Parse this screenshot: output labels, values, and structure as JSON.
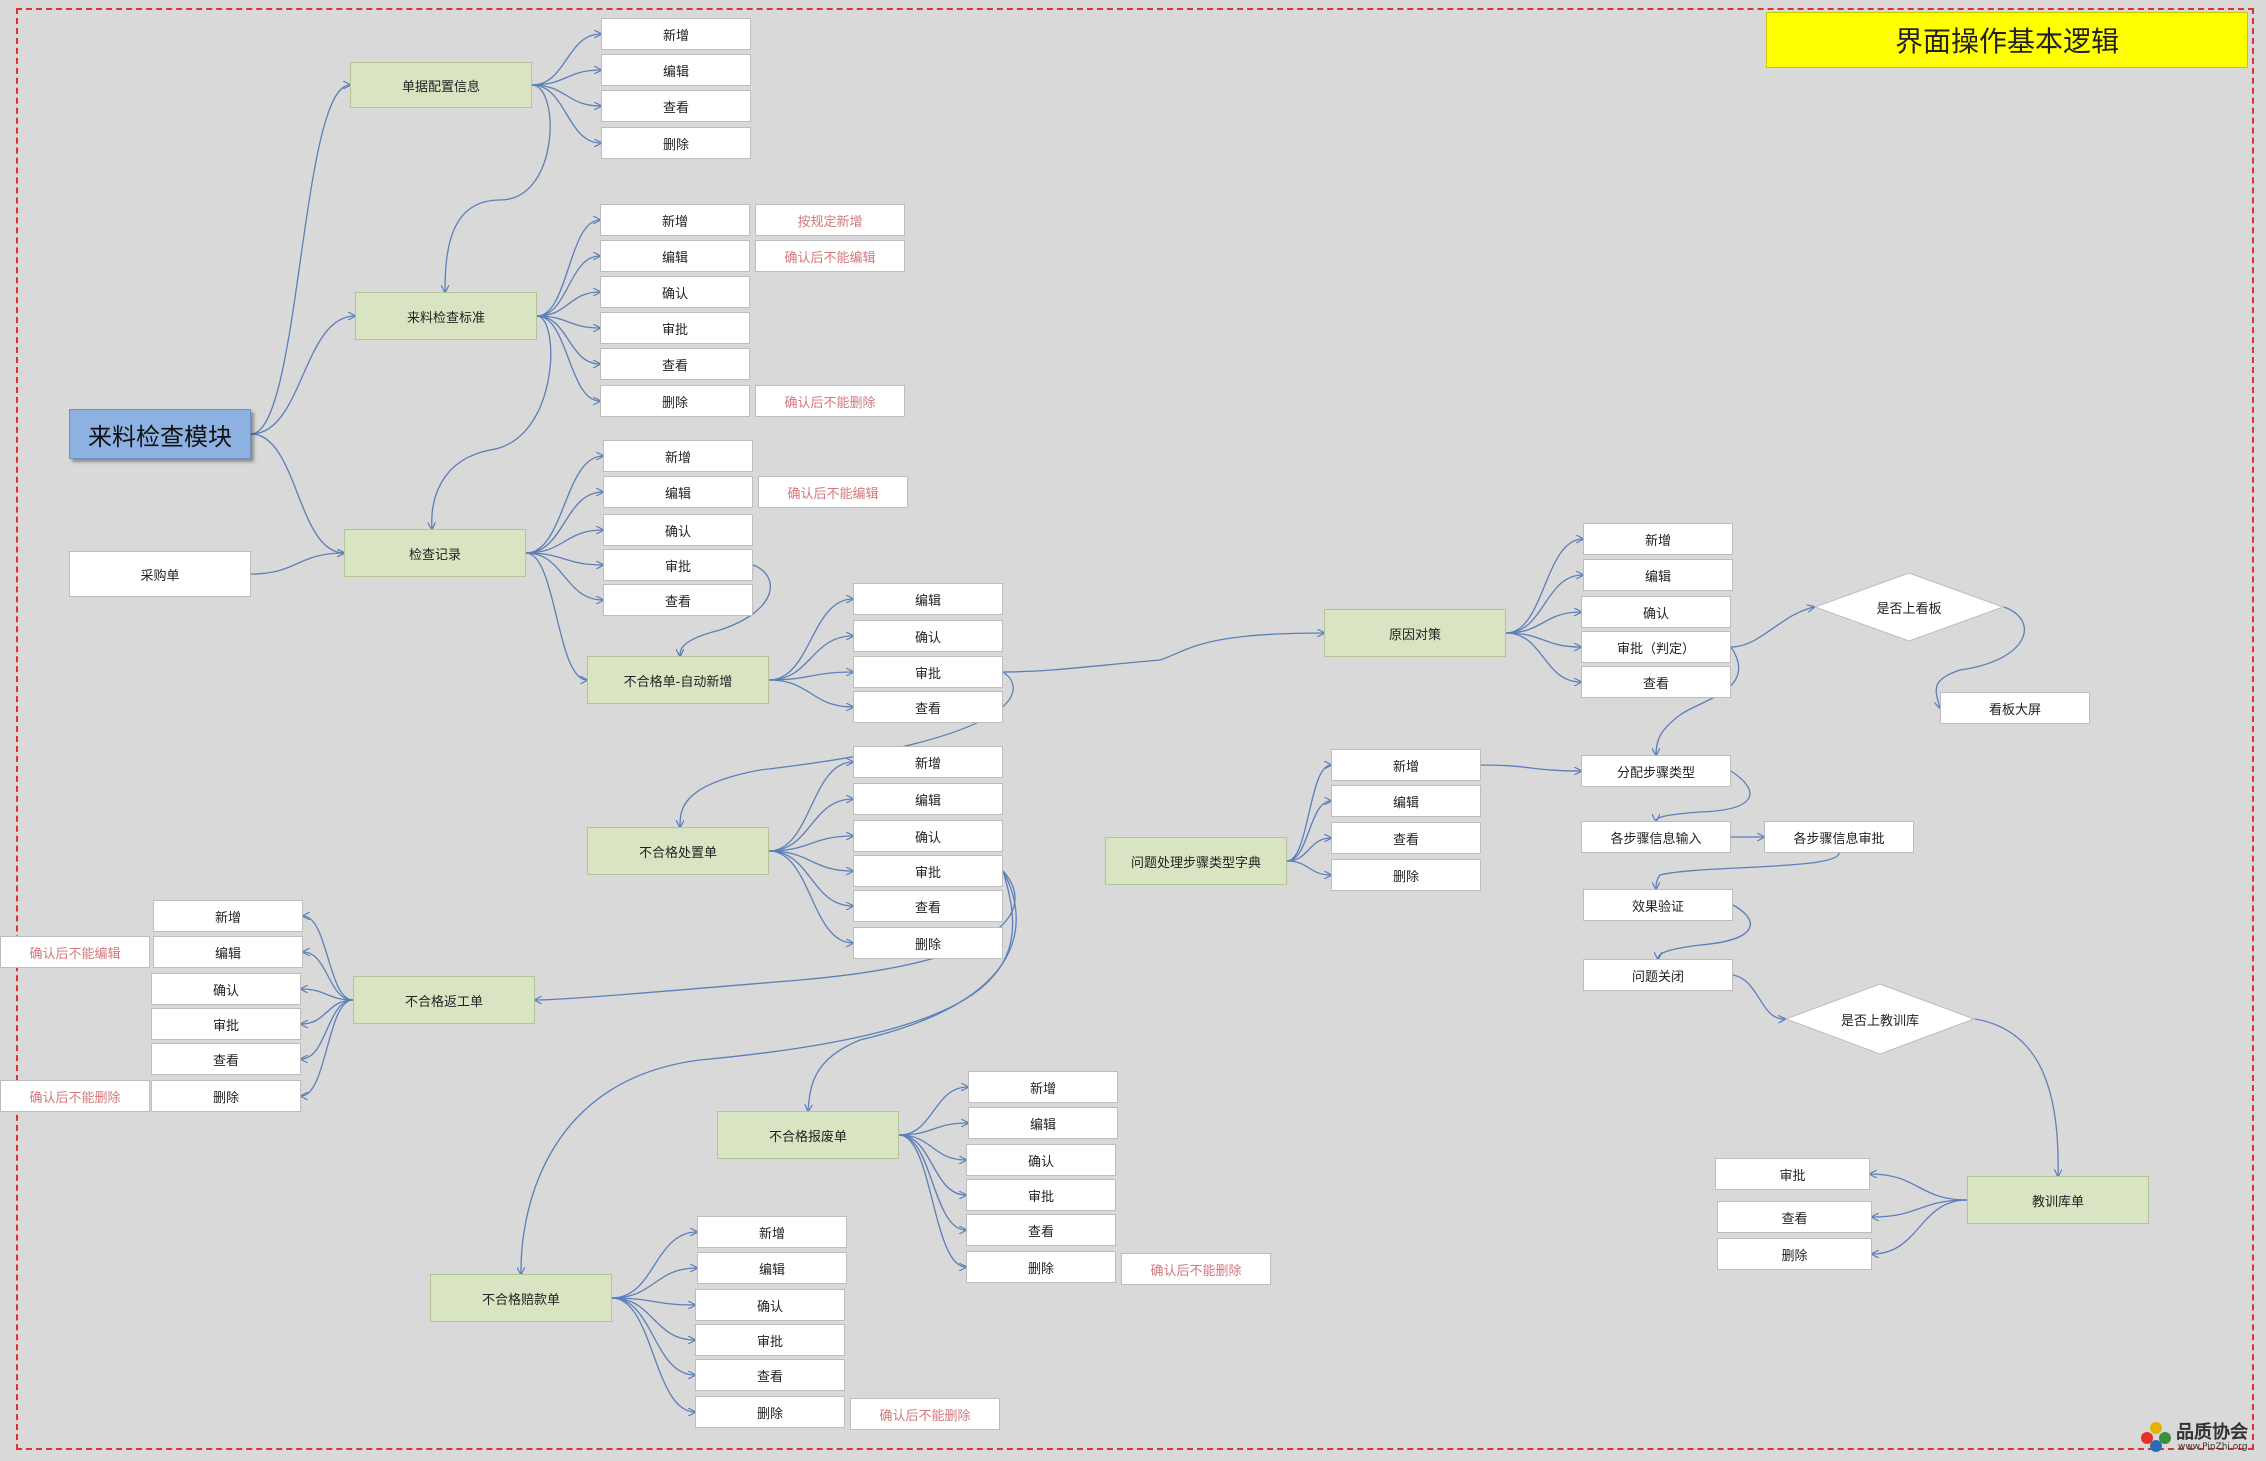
{
  "title": "界面操作基本逻辑",
  "root": "来料检查模块",
  "purchase_order": "采购单",
  "modules": {
    "doc_config": "单据配置信息",
    "inspection_standard": "来料检查标准",
    "inspection_record": "检查记录",
    "ncr_auto": "不合格单-自动新增",
    "ncr_disposal": "不合格处置单",
    "ncr_rework": "不合格返工单",
    "ncr_scrap": "不合格报废单",
    "ncr_claim": "不合格赔款单",
    "root_cause": "原因对策",
    "step_type_dict": "问题处理步骤类型字典",
    "lessons_lib": "教训库单"
  },
  "actions": {
    "add": "新增",
    "edit": "编辑",
    "view": "查看",
    "delete": "删除",
    "confirm": "确认",
    "approve": "审批",
    "approve_judge": "审批（判定）"
  },
  "notes": {
    "add_by_rule": "按规定新增",
    "no_edit_after_confirm": "确认后不能编辑",
    "no_delete_after_confirm": "确认后不能删除"
  },
  "flow": {
    "assign_step_type": "分配步骤类型",
    "step_info_input": "各步骤信息输入",
    "step_info_approve": "各步骤信息审批",
    "effect_verify": "效果验证",
    "issue_close": "问题关闭",
    "kanban_screen": "看板大屏"
  },
  "decisions": {
    "on_kanban": "是否上看板",
    "on_lessons": "是否上教训库"
  },
  "watermark": {
    "name": "品质协会",
    "url": "www.PinZhi.org"
  },
  "colors": {
    "background": "#d9d9d9",
    "module_fill": "#d9e5c2",
    "root_fill": "#8db1e1",
    "title_fill": "#ffff00",
    "note_text": "#d4777a",
    "connector": "#5b7fb8",
    "frame": "#e03030"
  }
}
